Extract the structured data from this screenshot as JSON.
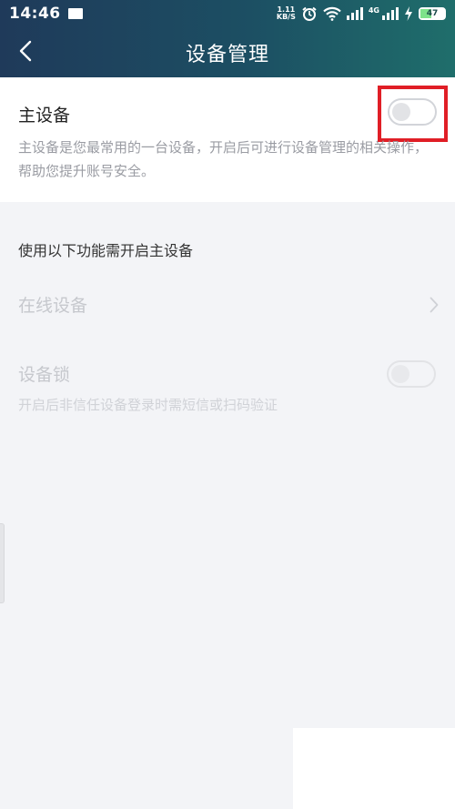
{
  "status_bar": {
    "time": "14:46",
    "speed_value": "1.11",
    "speed_unit": "KB/S",
    "network": "4G",
    "battery": "47",
    "battery_level": 0.47
  },
  "nav": {
    "title": "设备管理",
    "back_glyph": "‹"
  },
  "primary_device": {
    "title": "主设备",
    "description": "主设备是您最常用的一台设备，开启后可进行设备管理的相关操作，帮助您提升账号安全。",
    "toggle_on": false
  },
  "section": {
    "label": "使用以下功能需开启主设备"
  },
  "online_devices": {
    "label": "在线设备",
    "chevron": "›"
  },
  "device_lock": {
    "label": "设备锁",
    "description": "开启后非信任设备登录时需短信或扫码验证",
    "toggle_on": false
  },
  "colors": {
    "highlight": "#e01e26",
    "header_start": "#1f3a5a",
    "header_end": "#1f6e6b"
  }
}
